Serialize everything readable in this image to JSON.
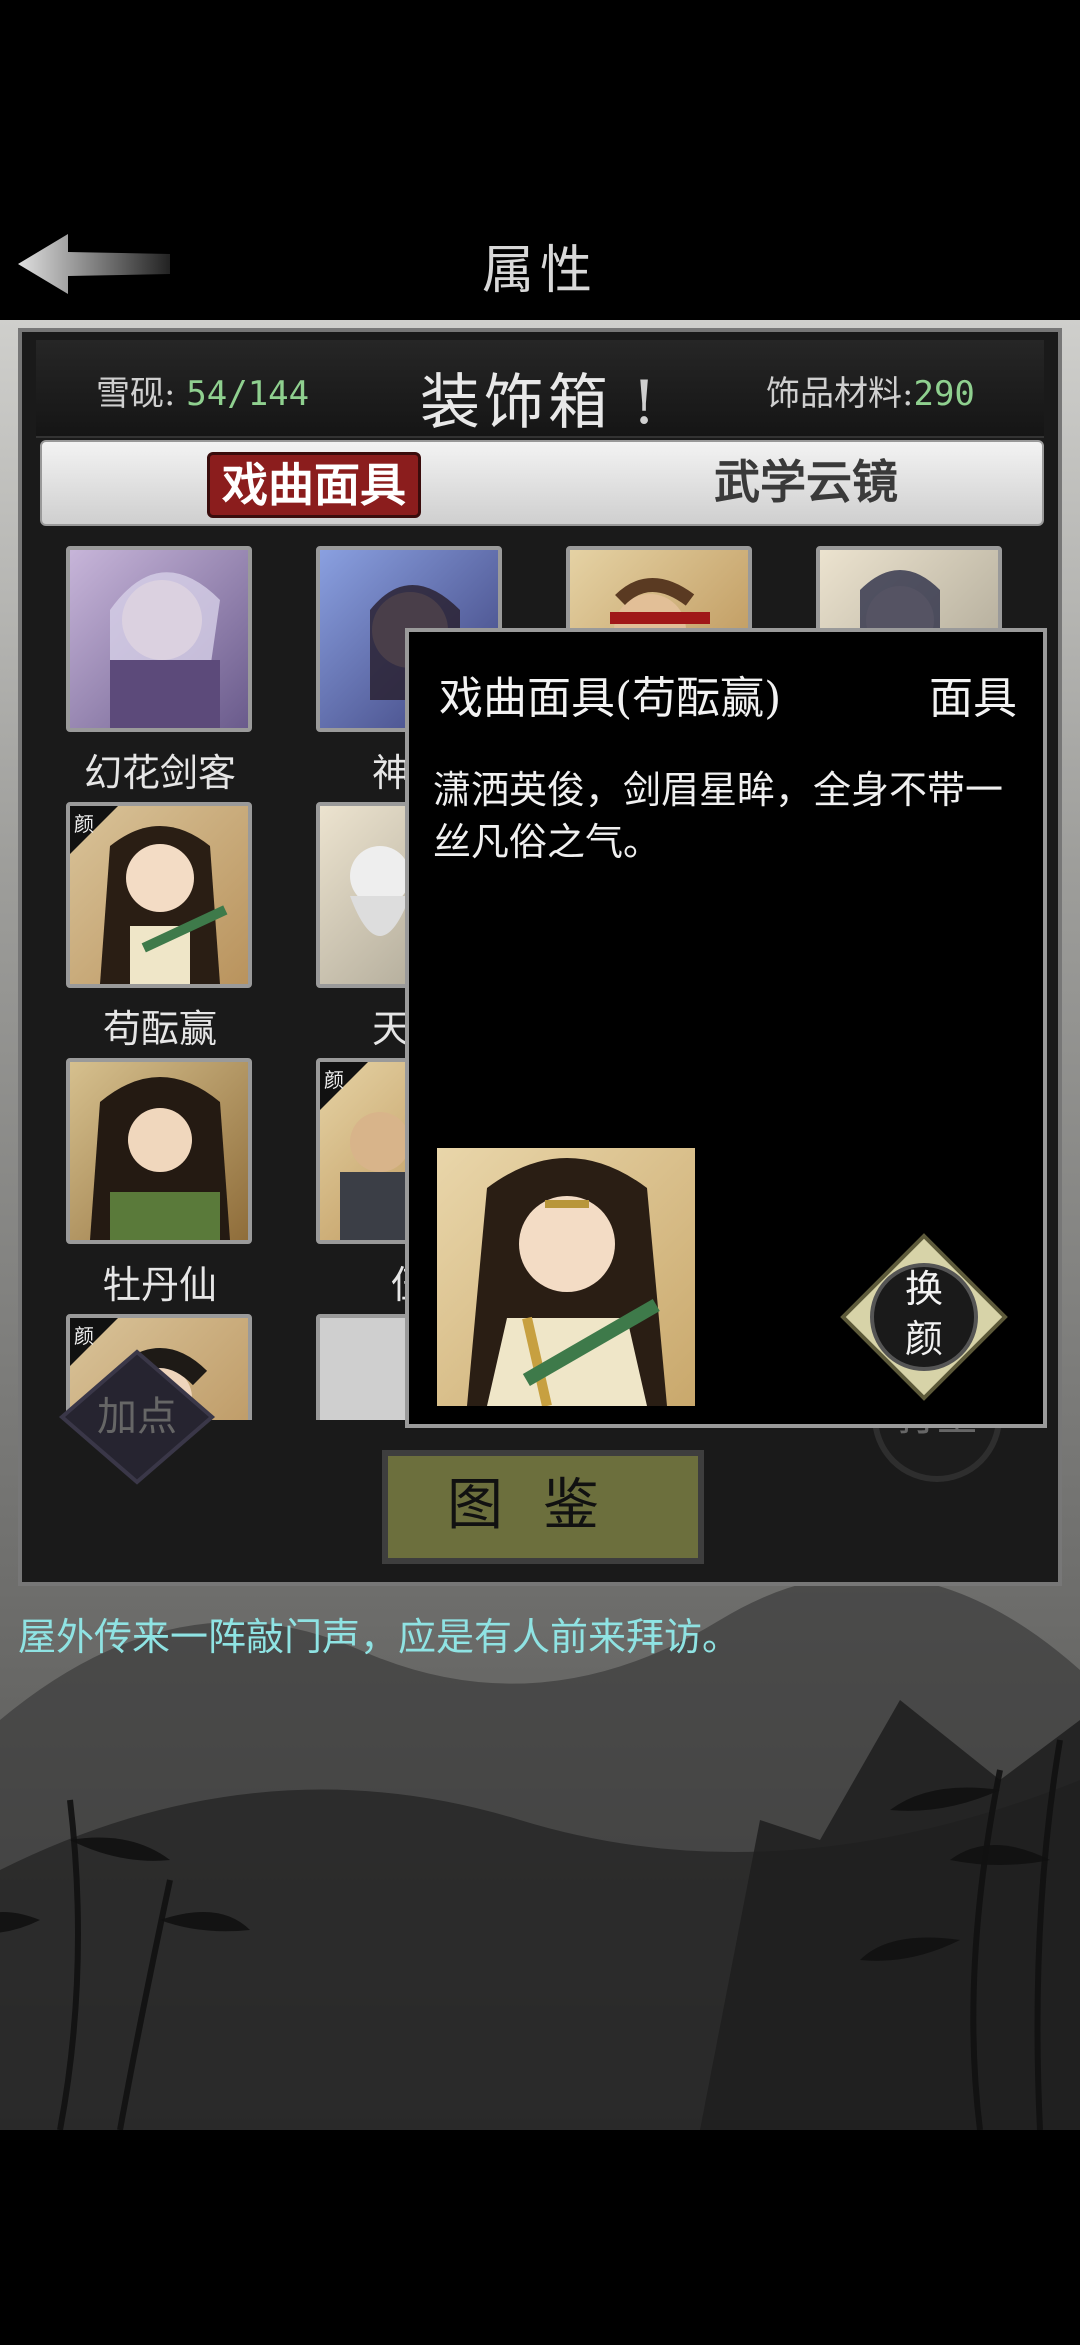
{
  "header": {
    "title": "属性",
    "back_icon": "back-arrow-icon"
  },
  "panel": {
    "title": "装饰箱",
    "title_mark": "!",
    "snow_ink_label": "雪砚:",
    "snow_ink_value": "54/144",
    "material_label": "饰品材料:",
    "material_value": "290"
  },
  "tabs": [
    {
      "label": "戏曲面具",
      "active": true
    },
    {
      "label": "武学云镜",
      "active": false
    }
  ],
  "items": [
    {
      "name": "幻花剑客",
      "tag": ""
    },
    {
      "name": "神使",
      "tag": ""
    },
    {
      "name": "",
      "tag": ""
    },
    {
      "name": "",
      "tag": ""
    },
    {
      "name": "苟酝赢",
      "tag": "颜"
    },
    {
      "name": "天机",
      "tag": ""
    },
    {
      "name": "牡丹仙",
      "tag": ""
    },
    {
      "name": "伍",
      "tag": "颜"
    },
    {
      "name": "",
      "tag": "颜"
    }
  ],
  "popup": {
    "title": "戏曲面具(苟酝赢)",
    "type": "面具",
    "description": "潇洒英俊，剑眉星眸，全身不带一丝凡俗之气。",
    "swap_button_line1": "换",
    "swap_button_line2": "颜"
  },
  "buttons": {
    "add_points": "加点",
    "meditate": "打坐",
    "atlas": "图鉴"
  },
  "message": "屋外传来一阵敲门声，应是有人前来拜访。",
  "colors": {
    "accent_green": "#8fd08f",
    "message_cyan": "#8fe3e3",
    "tab_red": "#8b1d1d"
  }
}
